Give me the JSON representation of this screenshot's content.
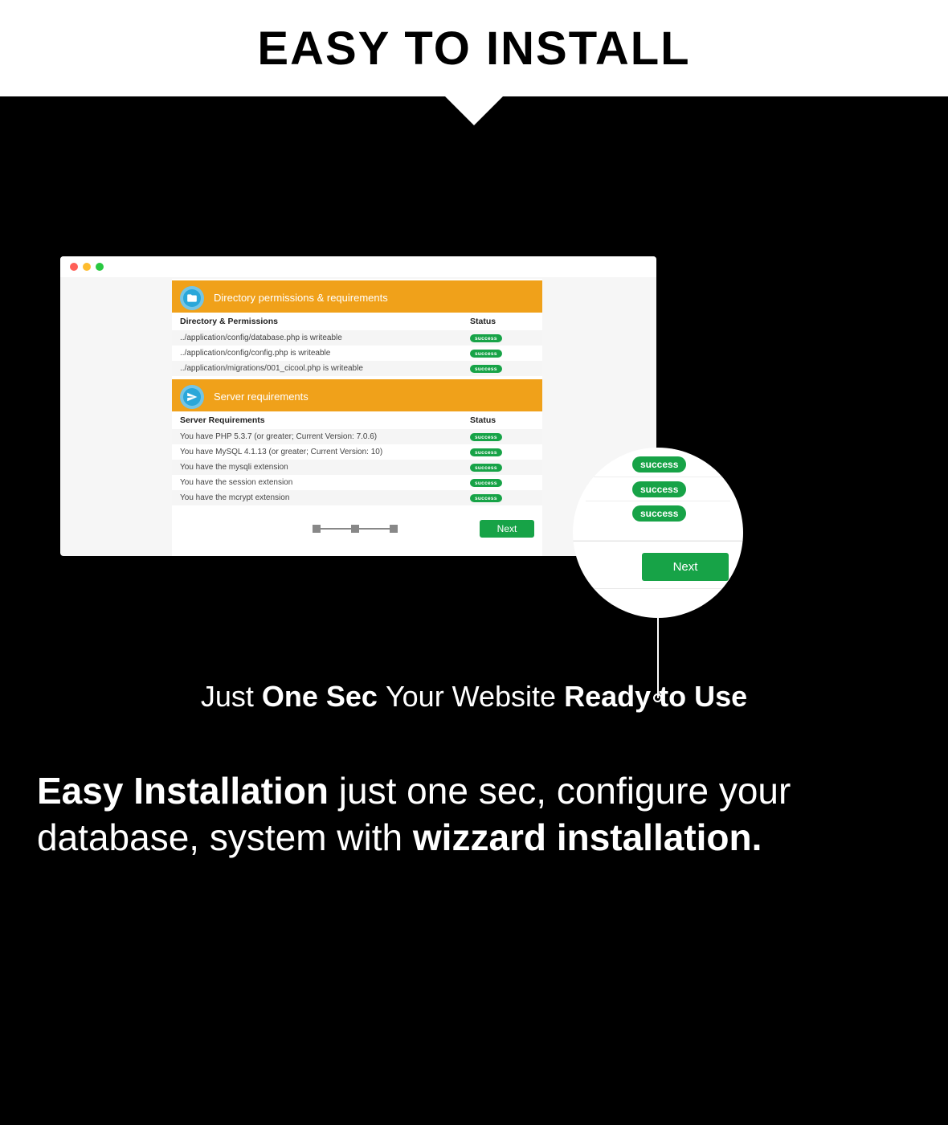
{
  "banner": {
    "title": "EASY TO INSTALL"
  },
  "installer": {
    "section1": {
      "title": "Directory permissions & requirements",
      "head_left": "Directory & Permissions",
      "head_right": "Status",
      "rows": [
        {
          "text": "../application/config/database.php is writeable",
          "status": "success"
        },
        {
          "text": "../application/config/config.php is writeable",
          "status": "success"
        },
        {
          "text": "../application/migrations/001_cicool.php is writeable",
          "status": "success"
        }
      ]
    },
    "section2": {
      "title": "Server requirements",
      "head_left": "Server Requirements",
      "head_right": "Status",
      "rows": [
        {
          "text": "You have PHP 5.3.7 (or greater; Current Version: 7.0.6)",
          "status": "success"
        },
        {
          "text": "You have MySQL 4.1.13 (or greater; Current Version: 10)",
          "status": "success"
        },
        {
          "text": "You have the mysqli extension",
          "status": "success"
        },
        {
          "text": "You have the session extension",
          "status": "success"
        },
        {
          "text": "You have the mcrypt extension",
          "status": "success"
        }
      ]
    },
    "next_label": "Next"
  },
  "magnifier": {
    "pill_label": "success",
    "next_label": "Next"
  },
  "tagline": {
    "p1": "Just ",
    "p2": "One Sec ",
    "p3": "Your Website ",
    "p4": "Ready to Use"
  },
  "paragraph": {
    "p1": "Easy Installation ",
    "p2": "just one sec, configure your database, system with ",
    "p3": "wizzard instal­lation."
  }
}
